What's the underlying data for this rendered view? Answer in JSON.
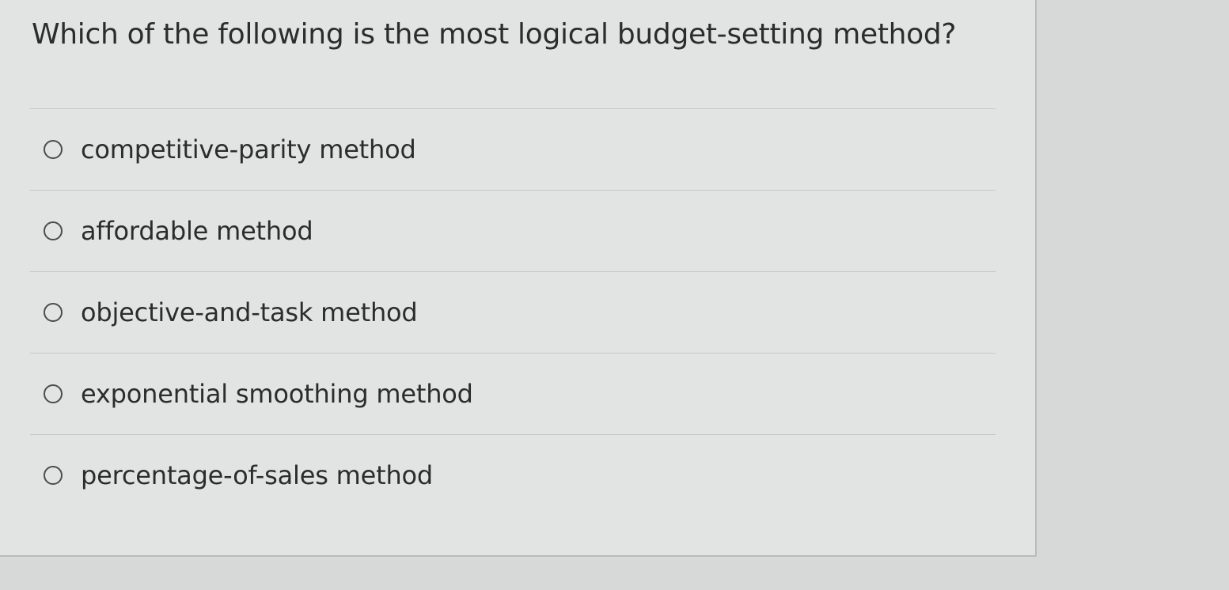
{
  "question": {
    "text": "Which of the following is the most logical budget-setting method?"
  },
  "answers": [
    {
      "label": "competitive-parity method",
      "selected": false
    },
    {
      "label": "affordable method",
      "selected": false
    },
    {
      "label": "objective-and-task method",
      "selected": false
    },
    {
      "label": "exponential smoothing method",
      "selected": false
    },
    {
      "label": "percentage-of-sales method",
      "selected": false
    }
  ]
}
